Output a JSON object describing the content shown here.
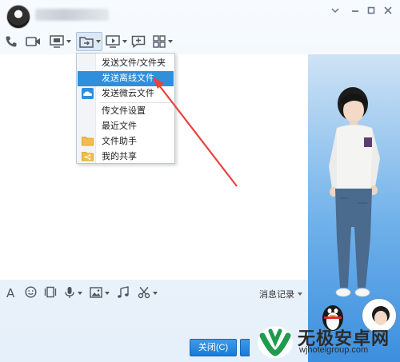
{
  "window": {
    "username_hidden": true,
    "controls": {
      "menu_icon": "chevron-down-icon",
      "minimize_icon": "minimize-icon",
      "maximize_icon": "maximize-icon",
      "close_icon": "close-icon"
    }
  },
  "toolbar": {
    "items": [
      {
        "name": "voice-call",
        "icon": "phone-icon",
        "dropdown": false
      },
      {
        "name": "video-call",
        "icon": "video-camera-icon",
        "dropdown": false
      },
      {
        "name": "remote-desktop",
        "icon": "remote-screen-icon",
        "dropdown": true
      },
      {
        "name": "send-file",
        "icon": "folder-send-icon",
        "dropdown": true,
        "active": true
      },
      {
        "name": "share-screen",
        "icon": "screen-share-icon",
        "dropdown": true
      },
      {
        "name": "create-group",
        "icon": "add-chat-icon",
        "dropdown": false
      },
      {
        "name": "app-grid",
        "icon": "app-grid-icon",
        "dropdown": true
      }
    ]
  },
  "file_menu": {
    "items": [
      {
        "label": "发送文件/文件夹",
        "icon": null,
        "highlighted": false
      },
      {
        "label": "发送离线文件",
        "icon": null,
        "highlighted": true
      },
      {
        "label": "发送微云文件",
        "icon": "weiyun-cloud-icon",
        "highlighted": false
      },
      {
        "label": "传文件设置",
        "icon": null,
        "highlighted": false
      },
      {
        "label": "最近文件",
        "icon": null,
        "highlighted": false
      },
      {
        "label": "文件助手",
        "icon": "folder-icon",
        "highlighted": false
      },
      {
        "label": "我的共享",
        "icon": "share-folder-icon",
        "highlighted": false
      }
    ]
  },
  "input_toolbar": {
    "items": [
      {
        "name": "font",
        "icon": "font-icon",
        "glyph": "A"
      },
      {
        "name": "emoji",
        "icon": "smiley-icon"
      },
      {
        "name": "shake",
        "icon": "window-shake-icon"
      },
      {
        "name": "voice-message",
        "icon": "microphone-icon",
        "dropdown": true
      },
      {
        "name": "image",
        "icon": "image-icon",
        "dropdown": true
      },
      {
        "name": "music",
        "icon": "music-note-icon"
      },
      {
        "name": "screenshot",
        "icon": "scissors-icon",
        "dropdown": true
      }
    ],
    "history_label": "消息记录"
  },
  "buttons": {
    "close_label": "关闭(C)"
  },
  "watermark": {
    "brand": "无极安卓网",
    "url": "wjhotelgroup.com"
  },
  "colors": {
    "accent": "#2f8fdc",
    "annotation_arrow": "#e84141",
    "button": "#1a7ad6"
  }
}
